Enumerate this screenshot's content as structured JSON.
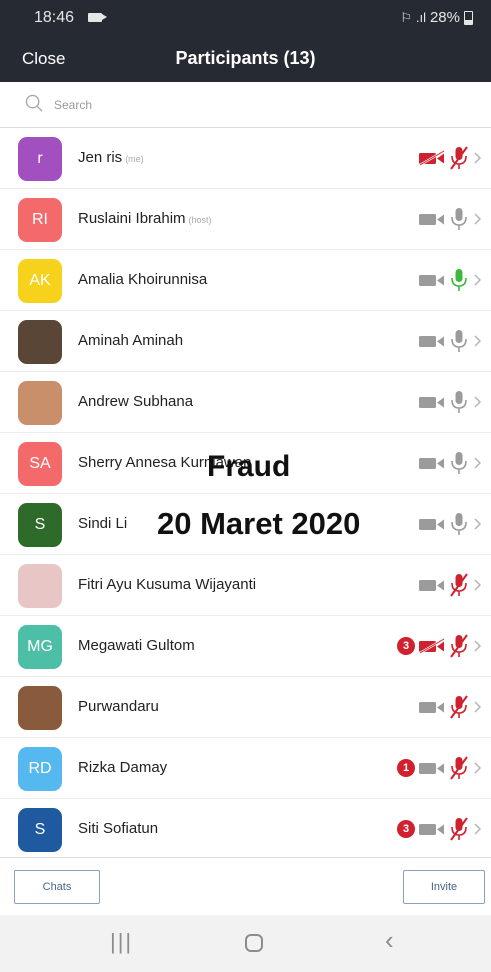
{
  "status_bar": {
    "time": "18:46",
    "battery_text": "28%",
    "wifi_glyph": "⚐",
    "signal_glyph": ".ıl"
  },
  "header": {
    "close_label": "Close",
    "title": "Participants (13)"
  },
  "search": {
    "placeholder": "Search"
  },
  "participants": [
    {
      "name": "Jen ris",
      "tag": "(me)",
      "initials": "r",
      "avatar_color": "#a24fbf",
      "video": "off",
      "mic": "muted",
      "badge": ""
    },
    {
      "name": "Ruslaini Ibrahim",
      "tag": "(host)",
      "initials": "RI",
      "avatar_color": "#f46a6a",
      "video": "on",
      "mic": "on",
      "badge": ""
    },
    {
      "name": "Amalia Khoirunnisa",
      "tag": "",
      "initials": "AK",
      "avatar_color": "#f7d21d",
      "video": "on",
      "mic": "speaking",
      "badge": ""
    },
    {
      "name": "Aminah Aminah",
      "tag": "",
      "initials": "",
      "avatar_color": "#5a4636",
      "video": "on",
      "mic": "on",
      "badge": ""
    },
    {
      "name": "Andrew Subhana",
      "tag": "",
      "initials": "",
      "avatar_color": "#c98e6a",
      "video": "on",
      "mic": "on",
      "badge": ""
    },
    {
      "name": "Sherry Annesa Kurniawan",
      "tag": "",
      "initials": "SA",
      "avatar_color": "#f46a6a",
      "video": "on",
      "mic": "on",
      "badge": ""
    },
    {
      "name": "Sindi Li",
      "tag": "",
      "initials": "S",
      "avatar_color": "#2e6b2b",
      "video": "on",
      "mic": "on",
      "badge": ""
    },
    {
      "name": "Fitri Ayu Kusuma Wijayanti",
      "tag": "",
      "initials": "",
      "avatar_color": "#e9c6c6",
      "video": "on",
      "mic": "muted",
      "badge": ""
    },
    {
      "name": "Megawati Gultom",
      "tag": "",
      "initials": "MG",
      "avatar_color": "#4dbfa6",
      "video": "off",
      "mic": "muted",
      "badge": "3"
    },
    {
      "name": "Purwandaru",
      "tag": "",
      "initials": "",
      "avatar_color": "#8a5a3c",
      "video": "on",
      "mic": "muted",
      "badge": ""
    },
    {
      "name": "Rizka Damay",
      "tag": "",
      "initials": "RD",
      "avatar_color": "#55b8ee",
      "video": "on",
      "mic": "muted",
      "badge": "1"
    },
    {
      "name": "Siti Sofiatun",
      "tag": "",
      "initials": "S",
      "avatar_color": "#1f5aa0",
      "video": "on",
      "mic": "muted",
      "badge": "3"
    }
  ],
  "overlay": {
    "title": "Fraud",
    "date": "20 Maret 2020"
  },
  "footer": {
    "chats_label": "Chats",
    "invite_label": "Invite"
  },
  "system_nav": {
    "recents_glyph": "|||",
    "back_glyph": "‹"
  },
  "colors": {
    "header_bg": "#262a33",
    "muted_red": "#d0212e",
    "speaking_green": "#3db83d",
    "inactive_gray": "#9b9b9b"
  }
}
